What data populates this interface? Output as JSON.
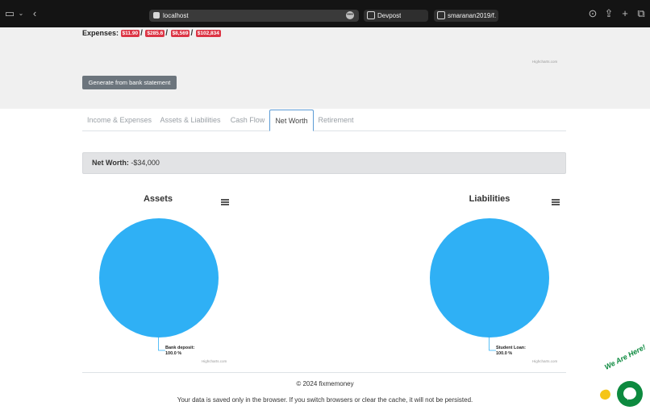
{
  "browser": {
    "url": "localhost",
    "tabs": [
      {
        "label": "Devpost"
      },
      {
        "label": "smaranan2019/f..."
      }
    ]
  },
  "expenses": {
    "label": "Expenses:",
    "badges": [
      "$11.90",
      "$285.6",
      "$8,569",
      "$102,834"
    ]
  },
  "highcharts_credit": "Highcharts.com",
  "generate_button": "Generate from bank statement",
  "tabs": [
    {
      "label": "Income & Expenses",
      "active": false
    },
    {
      "label": "Assets & Liabilities",
      "active": false
    },
    {
      "label": "Cash Flow",
      "active": false
    },
    {
      "label": "Net Worth",
      "active": true
    },
    {
      "label": "Retirement",
      "active": false
    }
  ],
  "net_worth": {
    "label": "Net Worth:",
    "value": "-$34,000"
  },
  "chart_data": [
    {
      "type": "pie",
      "title": "Assets",
      "slices": [
        {
          "name": "Bank deposit:",
          "percent_label": "100.0 %",
          "value": 100.0,
          "color": "#2fb0f5"
        }
      ]
    },
    {
      "type": "pie",
      "title": "Liabilities",
      "slices": [
        {
          "name": "Student Loan:",
          "percent_label": "100.0 %",
          "value": 100.0,
          "color": "#2fb0f5"
        }
      ]
    }
  ],
  "footer": {
    "copyright": "© 2024 fixmemoney",
    "notice": "Your data is saved only in the browser. If you switch browsers or clear the cache, it will not be persisted."
  },
  "chat_widget": {
    "tagline": "We Are Here!",
    "color": "#0d8a3f"
  }
}
